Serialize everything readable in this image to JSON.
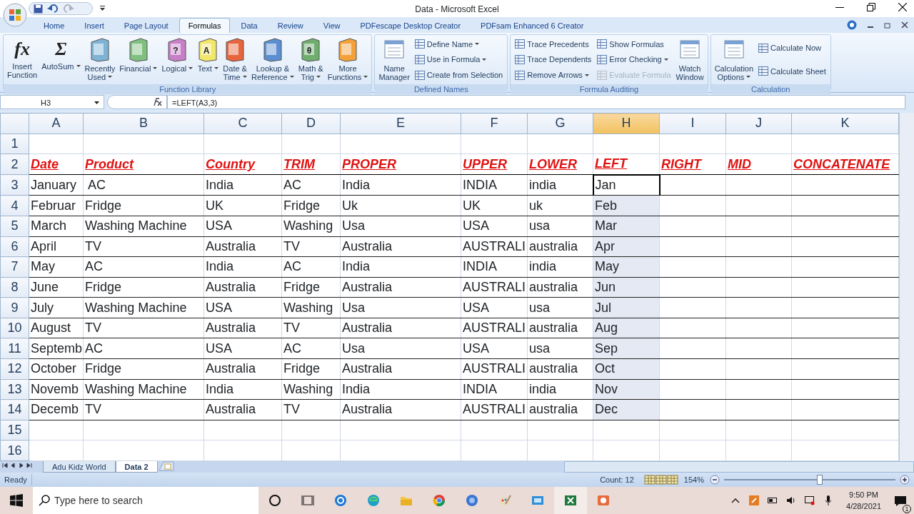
{
  "window": {
    "title": "Data - Microsoft Excel"
  },
  "tabs": [
    {
      "label": "Home",
      "selected": false
    },
    {
      "label": "Insert",
      "selected": false
    },
    {
      "label": "Page Layout",
      "selected": false
    },
    {
      "label": "Formulas",
      "selected": true
    },
    {
      "label": "Data",
      "selected": false
    },
    {
      "label": "Review",
      "selected": false
    },
    {
      "label": "View",
      "selected": false
    },
    {
      "label": "PDFescape Desktop Creator",
      "selected": false
    },
    {
      "label": "PDFsam Enhanced 6 Creator",
      "selected": false
    }
  ],
  "ribbon": {
    "groups": [
      {
        "label": "Function Library",
        "items": [
          {
            "kind": "glyph",
            "glyph": "fx",
            "lines": [
              "Insert",
              "Function"
            ],
            "dropdown": false
          },
          {
            "kind": "glyph",
            "glyph": "Σ",
            "lines": [
              "AutoSum"
            ],
            "dropdown": true
          },
          {
            "kind": "book",
            "color": "#7fb3d5",
            "lines": [
              "Recently",
              "Used"
            ],
            "dropdown": true
          },
          {
            "kind": "book",
            "color": "#7fbf7f",
            "lines": [
              "Financial"
            ],
            "dropdown": true
          },
          {
            "kind": "book",
            "color": "#c77fc7",
            "glyph": "?",
            "lines": [
              "Logical"
            ],
            "dropdown": true
          },
          {
            "kind": "book",
            "color": "#f2e66b",
            "glyph": "A",
            "lines": [
              "Text"
            ],
            "dropdown": true
          },
          {
            "kind": "book",
            "color": "#e8643c",
            "lines": [
              "Date &",
              "Time"
            ],
            "dropdown": true
          },
          {
            "kind": "book",
            "color": "#5b8fd1",
            "lines": [
              "Lookup &",
              "Reference"
            ],
            "dropdown": true
          },
          {
            "kind": "book",
            "color": "#6fae6f",
            "glyph": "θ",
            "lines": [
              "Math &",
              "Trig"
            ],
            "dropdown": true
          },
          {
            "kind": "book",
            "color": "#f4a13a",
            "lines": [
              "More",
              "Functions"
            ],
            "dropdown": true
          }
        ]
      },
      {
        "label": "Defined Names",
        "items": [
          {
            "kind": "tool",
            "lines": [
              "Name",
              "Manager"
            ],
            "dropdown": false
          },
          {
            "kind": "stack",
            "buttons": [
              {
                "label": "Define Name",
                "dropdown": true,
                "disabled": false
              },
              {
                "label": "Use in Formula",
                "dropdown": true,
                "disabled": false
              },
              {
                "label": "Create from Selection",
                "dropdown": false,
                "disabled": false
              }
            ]
          }
        ]
      },
      {
        "label": "Formula Auditing",
        "items": [
          {
            "kind": "stack",
            "buttons": [
              {
                "label": "Trace Precedents",
                "dropdown": false,
                "disabled": false
              },
              {
                "label": "Trace Dependents",
                "dropdown": false,
                "disabled": false
              },
              {
                "label": "Remove Arrows",
                "dropdown": true,
                "disabled": false
              }
            ]
          },
          {
            "kind": "stack",
            "buttons": [
              {
                "label": "Show Formulas",
                "dropdown": false,
                "disabled": false
              },
              {
                "label": "Error Checking",
                "dropdown": true,
                "disabled": false
              },
              {
                "label": "Evaluate Formula",
                "dropdown": false,
                "disabled": true
              }
            ]
          },
          {
            "kind": "tool",
            "lines": [
              "Watch",
              "Window"
            ],
            "dropdown": false
          }
        ]
      },
      {
        "label": "Calculation",
        "items": [
          {
            "kind": "tool",
            "lines": [
              "Calculation",
              "Options"
            ],
            "dropdown": true
          },
          {
            "kind": "stack",
            "buttons": [
              {
                "label": "Calculate Now",
                "dropdown": false,
                "disabled": false
              },
              {
                "label": "Calculate Sheet",
                "dropdown": false,
                "disabled": false
              }
            ]
          }
        ]
      }
    ]
  },
  "formula_bar": {
    "name_box": "H3",
    "formula": "=LEFT(A3,3)"
  },
  "sheet": {
    "columns": [
      {
        "label": "A",
        "selected": false
      },
      {
        "label": "B",
        "selected": false
      },
      {
        "label": "C",
        "selected": false
      },
      {
        "label": "D",
        "selected": false
      },
      {
        "label": "E",
        "selected": false
      },
      {
        "label": "F",
        "selected": false
      },
      {
        "label": "G",
        "selected": false
      },
      {
        "label": "H",
        "selected": true
      },
      {
        "label": "I",
        "selected": false
      },
      {
        "label": "J",
        "selected": false
      },
      {
        "label": "K",
        "selected": false
      }
    ],
    "rows": [
      {
        "number": "1",
        "kind": "blank",
        "selected": false,
        "cells": []
      },
      {
        "number": "2",
        "kind": "header",
        "selected": false,
        "cells": [
          "Date",
          "Product",
          "Country",
          "TRIM",
          "PROPER",
          "UPPER",
          "LOWER",
          "LEFT",
          "RIGHT",
          "MID",
          "CONCATENATE"
        ]
      },
      {
        "number": "3",
        "kind": "data",
        "selected": true,
        "cells": [
          "January",
          " AC",
          "India",
          "AC",
          "India",
          "INDIA",
          "india",
          "Jan"
        ]
      },
      {
        "number": "4",
        "kind": "data",
        "selected": true,
        "cells": [
          "Februar",
          "Fridge",
          "UK",
          "Fridge",
          "Uk",
          "UK",
          "uk",
          "Feb"
        ]
      },
      {
        "number": "5",
        "kind": "data",
        "selected": true,
        "cells": [
          "March",
          "Washing Machine",
          "USA",
          "Washing",
          "Usa",
          "USA",
          "usa",
          "Mar"
        ]
      },
      {
        "number": "6",
        "kind": "data",
        "selected": true,
        "cells": [
          "April",
          "TV",
          "Australia",
          "TV",
          "Australia",
          "AUSTRALI",
          "australia",
          "Apr"
        ]
      },
      {
        "number": "7",
        "kind": "data",
        "selected": true,
        "cells": [
          "May",
          "AC",
          "India",
          "AC",
          "India",
          "INDIA",
          "india",
          "May"
        ]
      },
      {
        "number": "8",
        "kind": "data",
        "selected": true,
        "cells": [
          "June",
          "Fridge",
          "Australia",
          "Fridge",
          "Australia",
          "AUSTRALI",
          "australia",
          "Jun"
        ]
      },
      {
        "number": "9",
        "kind": "data",
        "selected": true,
        "cells": [
          "July",
          "Washing Machine",
          "USA",
          "Washing",
          "Usa",
          "USA",
          "usa",
          "Jul"
        ]
      },
      {
        "number": "10",
        "kind": "data",
        "selected": true,
        "cells": [
          "August",
          "TV",
          "Australia",
          "TV",
          "Australia",
          "AUSTRALI",
          "australia",
          "Aug"
        ]
      },
      {
        "number": "11",
        "kind": "data",
        "selected": true,
        "cells": [
          "Septemb",
          "AC",
          "USA",
          "AC",
          "Usa",
          "USA",
          "usa",
          "Sep"
        ]
      },
      {
        "number": "12",
        "kind": "data",
        "selected": true,
        "cells": [
          "October",
          "Fridge",
          "Australia",
          "Fridge",
          "Australia",
          "AUSTRALI",
          "australia",
          "Oct"
        ]
      },
      {
        "number": "13",
        "kind": "data",
        "selected": true,
        "cells": [
          "Novemb",
          "Washing Machine",
          "India",
          "Washing",
          "India",
          "INDIA",
          "india",
          "Nov"
        ]
      },
      {
        "number": "14",
        "kind": "data",
        "selected": true,
        "cells": [
          "Decemb",
          "TV",
          "Australia",
          "TV",
          "Australia",
          "AUSTRALI",
          "australia",
          "Dec"
        ]
      },
      {
        "number": "15",
        "kind": "blank",
        "selected": false,
        "cells": []
      },
      {
        "number": "16",
        "kind": "blank",
        "selected": false,
        "cells": []
      }
    ]
  },
  "sheet_tabs": [
    {
      "label": "Adu Kidz World",
      "selected": false
    },
    {
      "label": "Data 2",
      "selected": true
    }
  ],
  "status_bar": {
    "mode": "Ready",
    "count": "Count: 12",
    "zoom": "154%",
    "zoom_slider": {
      "level": 0.56
    }
  },
  "taskbar": {
    "search": {
      "placeholder": "Type here to search"
    },
    "time": "9:50 PM",
    "date": "4/28/2021",
    "notifications": "1"
  }
}
